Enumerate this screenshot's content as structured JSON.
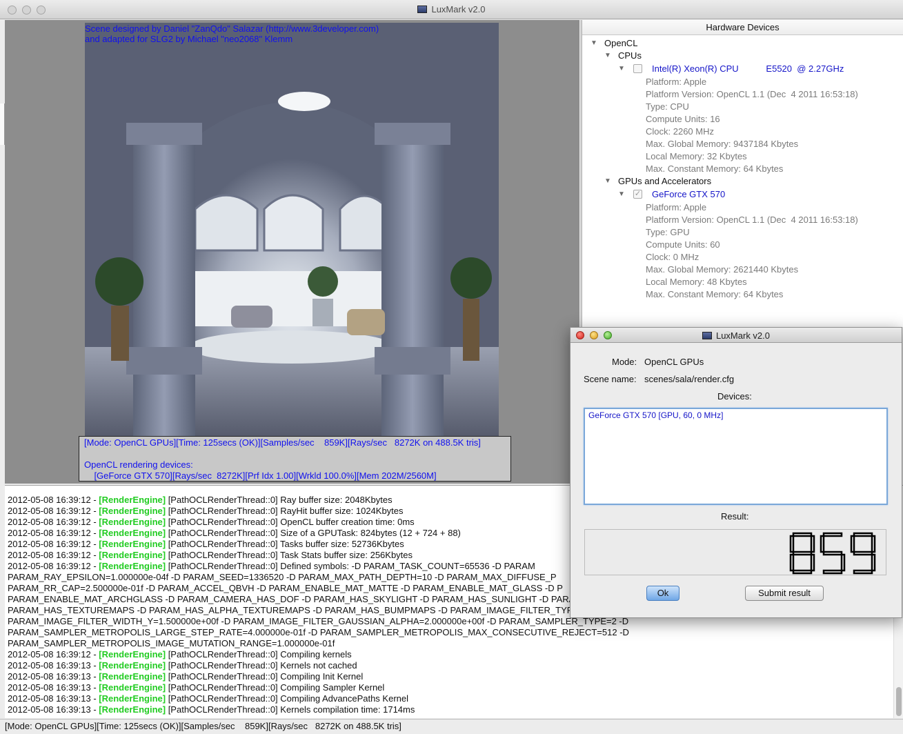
{
  "window": {
    "title": "LuxMark v2.0"
  },
  "render": {
    "credit_line1": "Scene designed by Daniel \"ZanQdo\" Salazar (http://www.3developer.com)",
    "credit_line2": "and adapted for SLG2 by Michael \"neo2068\" Klemm",
    "overlay_line1": "[Mode: OpenCL GPUs][Time: 125secs (OK)][Samples/sec    859K][Rays/sec   8272K on 488.5K tris]",
    "overlay_line2": "OpenCL rendering devices:",
    "overlay_line3": "    [GeForce GTX 570][Rays/sec  8272K][Prf Idx 1.00][Wrkld 100.0%][Mem 202M/2560M]"
  },
  "hardware": {
    "header": "Hardware Devices",
    "opencl": "OpenCL",
    "cpus": "CPUs",
    "cpu": {
      "name": "Intel(R) Xeon(R) CPU           E5520  @ 2.27GHz",
      "props": [
        "Platform: Apple",
        "Platform Version: OpenCL 1.1 (Dec  4 2011 16:53:18)",
        "Type: CPU",
        "Compute Units: 16",
        "Clock: 2260 MHz",
        "Max. Global Memory: 9437184 Kbytes",
        "Local Memory: 32 Kbytes",
        "Max. Constant Memory: 64 Kbytes"
      ]
    },
    "gpus": "GPUs and Accelerators",
    "gpu": {
      "name": "GeForce GTX 570",
      "props": [
        "Platform: Apple",
        "Platform Version: OpenCL 1.1 (Dec  4 2011 16:53:18)",
        "Type: GPU",
        "Compute Units: 60",
        "Clock: 0 MHz",
        "Max. Global Memory: 2621440 Kbytes",
        "Local Memory: 48 Kbytes",
        "Max. Constant Memory: 64 Kbytes"
      ]
    }
  },
  "log": [
    {
      "prefix": "2012-05-08 16:39:12 - ",
      "tag": "[RenderEngine]",
      "text": " [PathOCLRenderThread::0] Ray buffer size: 2048Kbytes"
    },
    {
      "prefix": "2012-05-08 16:39:12 - ",
      "tag": "[RenderEngine]",
      "text": " [PathOCLRenderThread::0] RayHit buffer size: 1024Kbytes"
    },
    {
      "prefix": "2012-05-08 16:39:12 - ",
      "tag": "[RenderEngine]",
      "text": " [PathOCLRenderThread::0] OpenCL buffer creation time: 0ms"
    },
    {
      "prefix": "2012-05-08 16:39:12 - ",
      "tag": "[RenderEngine]",
      "text": " [PathOCLRenderThread::0] Size of a GPUTask: 824bytes (12 + 724 + 88)"
    },
    {
      "prefix": "2012-05-08 16:39:12 - ",
      "tag": "[RenderEngine]",
      "text": " [PathOCLRenderThread::0] Tasks buffer size: 52736Kbytes"
    },
    {
      "prefix": "2012-05-08 16:39:12 - ",
      "tag": "[RenderEngine]",
      "text": " [PathOCLRenderThread::0] Task Stats buffer size: 256Kbytes"
    },
    {
      "prefix": "2012-05-08 16:39:12 - ",
      "tag": "[RenderEngine]",
      "text": " [PathOCLRenderThread::0] Defined symbols: -D PARAM_TASK_COUNT=65536 -D PARAM"
    },
    {
      "prefix": "PARAM_RAY_EPSILON=1.000000e-04f -D PARAM_SEED=1336520 -D PARAM_MAX_PATH_DEPTH=10 -D PARAM_MAX_DIFFUSE_P",
      "tag": "",
      "text": ""
    },
    {
      "prefix": "PARAM_RR_CAP=2.500000e-01f -D PARAM_ACCEL_QBVH -D PARAM_ENABLE_MAT_MATTE -D PARAM_ENABLE_MAT_GLASS -D P",
      "tag": "",
      "text": ""
    },
    {
      "prefix": "PARAM_ENABLE_MAT_ARCHGLASS -D PARAM_CAMERA_HAS_DOF -D PARAM_HAS_SKYLIGHT -D PARAM_HAS_SUNLIGHT -D PARAM",
      "tag": "",
      "text": ""
    },
    {
      "prefix": "PARAM_HAS_TEXTUREMAPS -D PARAM_HAS_ALPHA_TEXTUREMAPS -D PARAM_HAS_BUMPMAPS -D PARAM_IMAGE_FILTER_TYPE=2",
      "tag": "",
      "text": ""
    },
    {
      "prefix": "PARAM_IMAGE_FILTER_WIDTH_Y=1.500000e+00f -D PARAM_IMAGE_FILTER_GAUSSIAN_ALPHA=2.000000e+00f -D PARAM_SAMPLER_TYPE=2 -D",
      "tag": "",
      "text": ""
    },
    {
      "prefix": "PARAM_SAMPLER_METROPOLIS_LARGE_STEP_RATE=4.000000e-01f -D PARAM_SAMPLER_METROPOLIS_MAX_CONSECUTIVE_REJECT=512 -D",
      "tag": "",
      "text": ""
    },
    {
      "prefix": "PARAM_SAMPLER_METROPOLIS_IMAGE_MUTATION_RANGE=1.000000e-01f",
      "tag": "",
      "text": ""
    },
    {
      "prefix": "2012-05-08 16:39:12 - ",
      "tag": "[RenderEngine]",
      "text": " [PathOCLRenderThread::0] Compiling kernels"
    },
    {
      "prefix": "2012-05-08 16:39:13 - ",
      "tag": "[RenderEngine]",
      "text": " [PathOCLRenderThread::0] Kernels not cached"
    },
    {
      "prefix": "2012-05-08 16:39:13 - ",
      "tag": "[RenderEngine]",
      "text": " [PathOCLRenderThread::0] Compiling Init Kernel"
    },
    {
      "prefix": "2012-05-08 16:39:13 - ",
      "tag": "[RenderEngine]",
      "text": " [PathOCLRenderThread::0] Compiling Sampler Kernel"
    },
    {
      "prefix": "2012-05-08 16:39:13 - ",
      "tag": "[RenderEngine]",
      "text": " [PathOCLRenderThread::0] Compiling AdvancePaths Kernel"
    },
    {
      "prefix": "2012-05-08 16:39:13 - ",
      "tag": "[RenderEngine]",
      "text": " [PathOCLRenderThread::0] Kernels compilation time: 1714ms"
    }
  ],
  "statusbar": "[Mode: OpenCL GPUs][Time: 125secs (OK)][Samples/sec    859K][Rays/sec   8272K on 488.5K tris]",
  "dialog": {
    "title": "LuxMark v2.0",
    "mode_label": "Mode:",
    "mode_value": "OpenCL GPUs",
    "scene_label": "Scene name:",
    "scene_value": "scenes/sala/render.cfg",
    "devices_label": "Devices:",
    "devices_value": "GeForce GTX 570 [GPU, 60, 0 MHz]",
    "result_label": "Result:",
    "result_value": "859",
    "ok_label": "Ok",
    "submit_label": "Submit result"
  },
  "colors": {
    "link_blue": "#1414c8",
    "log_tag_green": "#22cc22",
    "lcd_digits": "#000000"
  }
}
